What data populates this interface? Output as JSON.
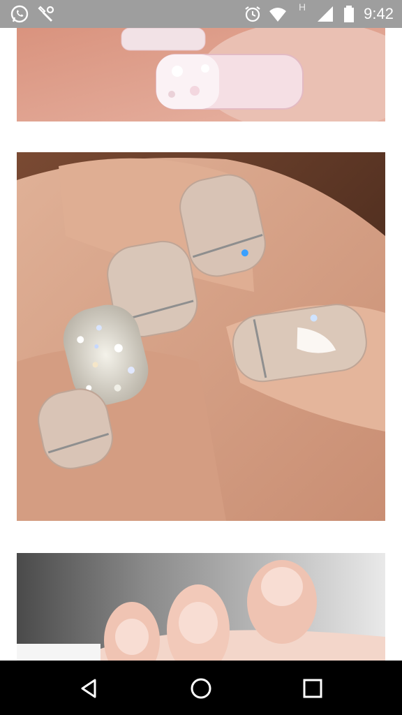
{
  "status_bar": {
    "time": "9:42",
    "network_label": "H",
    "icons": [
      "whatsapp-icon",
      "tools-icon",
      "alarm-icon",
      "wifi-icon",
      "signal-icon",
      "battery-icon"
    ],
    "background": "#9e9e9e"
  },
  "feed": {
    "images": [
      {
        "subject": "nail-art-photo-pink-crystal"
      },
      {
        "subject": "nail-art-photo-nude-glitter"
      },
      {
        "subject": "nail-art-photo-nude-pink"
      }
    ]
  },
  "nav_bar": {
    "buttons": [
      "back-button",
      "home-button",
      "recents-button"
    ],
    "background": "#000000"
  }
}
